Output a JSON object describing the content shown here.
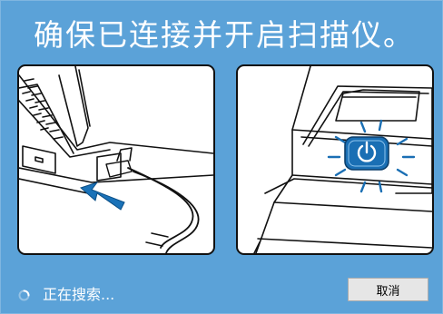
{
  "dialog": {
    "instruction": "确保已连接并开启扫描仪。",
    "status_text": "正在搜索...",
    "cancel_label": "取消"
  },
  "colors": {
    "background": "#5ba2d8",
    "arrow": "#1a72b8",
    "power_button": "#1a6fb4",
    "text": "#ffffff"
  }
}
